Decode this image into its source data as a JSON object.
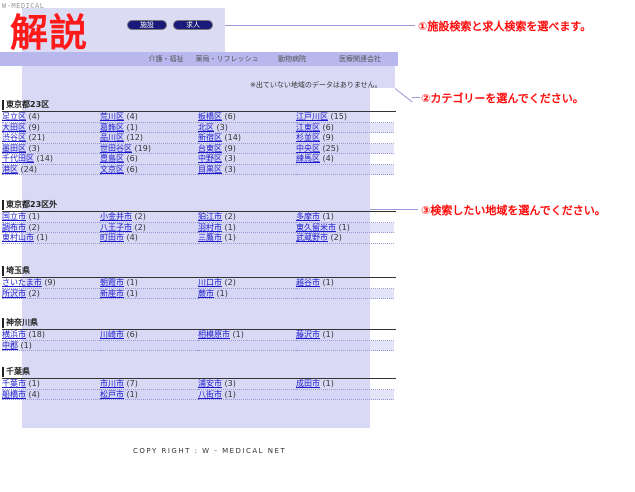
{
  "site_logo": "W-MEDICAL",
  "overlay_title": "解説",
  "search_tabs": [
    "施設",
    "求人"
  ],
  "nav": [
    "介護・福祉",
    "薬局・リフレッシュ",
    "動物病院",
    "医療関連会社"
  ],
  "no_data_notice": "※出ていない地域のデータはありません。",
  "regions": [
    {
      "title": "東京都23区",
      "cities": [
        {
          "name": "足立区",
          "count": "(4)"
        },
        {
          "name": "荒川区",
          "count": "(4)"
        },
        {
          "name": "板橋区",
          "count": "(6)"
        },
        {
          "name": "江戸川区",
          "count": "(15)"
        },
        {
          "name": "大田区",
          "count": "(9)"
        },
        {
          "name": "葛飾区",
          "count": "(1)"
        },
        {
          "name": "北区",
          "count": "(3)"
        },
        {
          "name": "江東区",
          "count": "(6)"
        },
        {
          "name": "渋谷区",
          "count": "(21)"
        },
        {
          "name": "品川区",
          "count": "(12)"
        },
        {
          "name": "新宿区",
          "count": "(14)"
        },
        {
          "name": "杉並区",
          "count": "(9)"
        },
        {
          "name": "墨田区",
          "count": "(3)"
        },
        {
          "name": "世田谷区",
          "count": "(19)"
        },
        {
          "name": "台東区",
          "count": "(9)"
        },
        {
          "name": "中央区",
          "count": "(25)"
        },
        {
          "name": "千代田区",
          "count": "(14)"
        },
        {
          "name": "豊島区",
          "count": "(6)"
        },
        {
          "name": "中野区",
          "count": "(3)"
        },
        {
          "name": "練馬区",
          "count": "(4)"
        },
        {
          "name": "港区",
          "count": "(24)"
        },
        {
          "name": "文京区",
          "count": "(6)"
        },
        {
          "name": "目黒区",
          "count": "(3)"
        }
      ]
    },
    {
      "title": "東京都23区外",
      "cities": [
        {
          "name": "国立市",
          "count": "(1)"
        },
        {
          "name": "小金井市",
          "count": "(2)"
        },
        {
          "name": "狛江市",
          "count": "(2)"
        },
        {
          "name": "多摩市",
          "count": "(1)"
        },
        {
          "name": "調布市",
          "count": "(2)"
        },
        {
          "name": "八王子市",
          "count": "(2)"
        },
        {
          "name": "羽村市",
          "count": "(1)"
        },
        {
          "name": "東久留米市",
          "count": "(1)"
        },
        {
          "name": "東村山市",
          "count": "(1)"
        },
        {
          "name": "町田市",
          "count": "(4)"
        },
        {
          "name": "三鷹市",
          "count": "(1)"
        },
        {
          "name": "武蔵野市",
          "count": "(2)"
        }
      ]
    },
    {
      "title": "埼玉県",
      "cities": [
        {
          "name": "さいたま市",
          "count": "(9)"
        },
        {
          "name": "朝霞市",
          "count": "(1)"
        },
        {
          "name": "川口市",
          "count": "(2)"
        },
        {
          "name": "越谷市",
          "count": "(1)"
        },
        {
          "name": "所沢市",
          "count": "(2)"
        },
        {
          "name": "新座市",
          "count": "(1)"
        },
        {
          "name": "蕨市",
          "count": "(1)"
        }
      ]
    },
    {
      "title": "神奈川県",
      "cities": [
        {
          "name": "横浜市",
          "count": "(18)"
        },
        {
          "name": "川崎市",
          "count": "(6)"
        },
        {
          "name": "相模原市",
          "count": "(1)"
        },
        {
          "name": "藤沢市",
          "count": "(1)"
        },
        {
          "name": "中郡",
          "count": "(1)"
        }
      ]
    },
    {
      "title": "千葉県",
      "cities": [
        {
          "name": "千葉市",
          "count": "(1)"
        },
        {
          "name": "市川市",
          "count": "(7)"
        },
        {
          "name": "浦安市",
          "count": "(3)"
        },
        {
          "name": "成田市",
          "count": "(1)"
        },
        {
          "name": "船橋市",
          "count": "(4)"
        },
        {
          "name": "松戸市",
          "count": "(1)"
        },
        {
          "name": "八街市",
          "count": "(1)"
        }
      ]
    }
  ],
  "footer": "COPY RIGHT : W - MEDICAL NET",
  "callouts": [
    "①施設検索と求人検索を選べます。",
    "②カテゴリーを選んでください。",
    "③検索したい地域を選んでください。"
  ],
  "colors": {
    "accent_red": "#ff1a1a",
    "link_blue": "#1a1acc",
    "overlay": "#aaaaeb"
  }
}
